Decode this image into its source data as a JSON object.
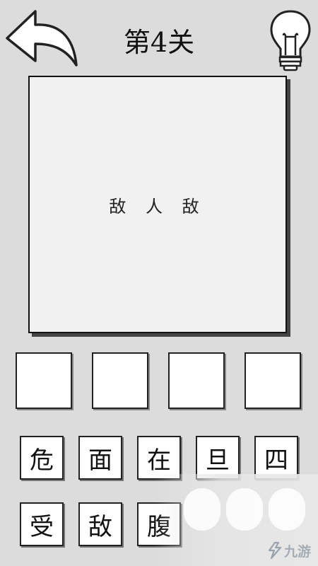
{
  "header": {
    "title": "第4关"
  },
  "puzzle": {
    "text": "敌 人 敌"
  },
  "answer_slots": [
    "",
    "",
    "",
    ""
  ],
  "candidate_tiles": {
    "row1": [
      "危",
      "面",
      "在",
      "旦",
      "四"
    ],
    "row2": [
      "受",
      "敌",
      "腹"
    ]
  },
  "watermark": {
    "text": "九游"
  }
}
